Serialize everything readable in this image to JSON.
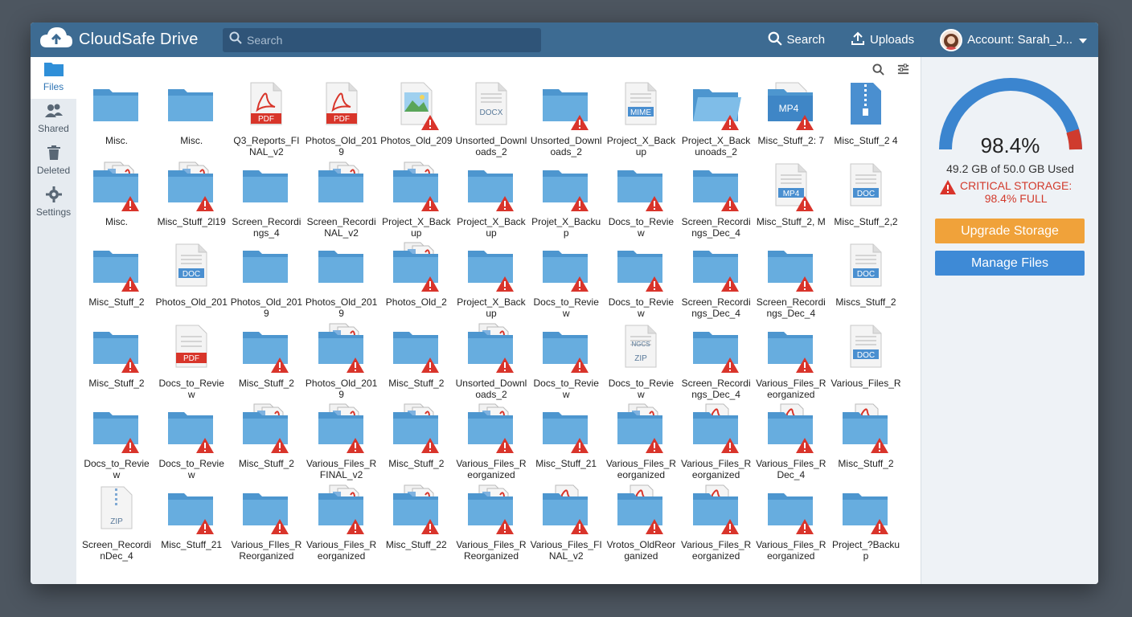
{
  "app": {
    "name": "CloudSafe Drive"
  },
  "search": {
    "placeholder": "Search"
  },
  "top": {
    "search_label": "Search",
    "uploads_label": "Uploads",
    "account_label": "Account: Sarah_J..."
  },
  "sidebar": {
    "items": [
      {
        "label": "Files",
        "icon": "folder-icon"
      },
      {
        "label": "Shared",
        "icon": "people-icon"
      },
      {
        "label": "Deleted",
        "icon": "trash-icon"
      },
      {
        "label": "Settings",
        "icon": "gear-icon"
      }
    ]
  },
  "storage": {
    "percent_label": "98.4%",
    "percent_value": 0.984,
    "used_label": "49.2 GB of 50.0 GB Used",
    "critical_line1": "CRITICAL STORAGE:",
    "critical_line2": "98.4% FULL",
    "upgrade_label": "Upgrade Storage",
    "manage_label": "Manage Files"
  },
  "colors": {
    "accent": "#3d6b92",
    "folder": "#5aa3d8",
    "warning": "#d9342b",
    "upgrade": "#f0a23a",
    "manage": "#3e8ad6"
  },
  "files": [
    {
      "name": "Misc.",
      "type": "folder",
      "warn": false
    },
    {
      "name": "Misc.",
      "type": "folder",
      "warn": false
    },
    {
      "name": "Q3_Reports_FINAL_v2",
      "type": "pdf",
      "warn": false
    },
    {
      "name": "Photos_Old_2019",
      "type": "pdf",
      "warn": false
    },
    {
      "name": "Photos_Old_209",
      "type": "image",
      "warn": true
    },
    {
      "name": "Unsorted_Downloads_2",
      "type": "docx",
      "warn": false
    },
    {
      "name": "Unsorted_Downloads_2",
      "type": "folder",
      "warn": true
    },
    {
      "name": "Project_X_Backup",
      "type": "mime",
      "warn": false
    },
    {
      "name": "Project_X_Backunoads_2",
      "type": "openfolder",
      "warn": true
    },
    {
      "name": "Misc_Stuff_2: 7",
      "type": "mp4folder",
      "warn": true
    },
    {
      "name": "Misc_Stuff_2 4",
      "type": "zipblue",
      "warn": false
    },
    {
      "name": "Misc.",
      "type": "stuffed",
      "warn": true
    },
    {
      "name": "Misc_Stuff_2l19",
      "type": "stuffed",
      "warn": true
    },
    {
      "name": "Screen_Recordings_4",
      "type": "folder",
      "warn": false
    },
    {
      "name": "Screen_RecordiNAL_v2",
      "type": "stuffed",
      "warn": false
    },
    {
      "name": "Project_X_Backup",
      "type": "stuffed",
      "warn": true
    },
    {
      "name": "Project_X_Backup",
      "type": "folder",
      "warn": true
    },
    {
      "name": "Projet_X_Backup",
      "type": "folder",
      "warn": true
    },
    {
      "name": "Docs_to_Review",
      "type": "folder",
      "warn": true
    },
    {
      "name": "Screen_Recordings_Dec_4",
      "type": "folder",
      "warn": true
    },
    {
      "name": "Misc_Stuff_2, M",
      "type": "mp4",
      "warn": true
    },
    {
      "name": "Misc_Stuff_2,2",
      "type": "doc",
      "warn": false
    },
    {
      "name": "Misc_Stuff_2",
      "type": "folder",
      "warn": true
    },
    {
      "name": "Photos_Old_201",
      "type": "doc",
      "warn": false
    },
    {
      "name": "Photos_Old_2019",
      "type": "folder",
      "warn": false
    },
    {
      "name": "Photos_Old_2019",
      "type": "folder",
      "warn": false
    },
    {
      "name": "Photos_Old_2",
      "type": "stuffed",
      "warn": true
    },
    {
      "name": "Project_X_Backup",
      "type": "folder",
      "warn": true
    },
    {
      "name": "Docs_to_Review",
      "type": "folder",
      "warn": true
    },
    {
      "name": "Docs_to_Review",
      "type": "folder",
      "warn": true
    },
    {
      "name": "Screen_Recordings_Dec_4",
      "type": "folder",
      "warn": true
    },
    {
      "name": "Screen_Recordings_Dec_4",
      "type": "folder",
      "warn": true
    },
    {
      "name": "Miscs_Stuff_2",
      "type": "doc",
      "warn": false
    },
    {
      "name": "Misc_Stuff_2",
      "type": "folder",
      "warn": true
    },
    {
      "name": "Docs_to_Review",
      "type": "pdfdoc",
      "warn": false
    },
    {
      "name": "Misc_Stuff_2",
      "type": "folder",
      "warn": true
    },
    {
      "name": "Photos_Old_2019",
      "type": "stuffed",
      "warn": true
    },
    {
      "name": "Misc_Stuff_2",
      "type": "folder",
      "warn": true
    },
    {
      "name": "Unsorted_Downloads_2",
      "type": "stuffed",
      "warn": true
    },
    {
      "name": "Docs_to_Review",
      "type": "folder",
      "warn": true
    },
    {
      "name": "Docs_to_Review",
      "type": "zip",
      "warn": false
    },
    {
      "name": "Screen_Recordings_Dec_4",
      "type": "folder",
      "warn": true
    },
    {
      "name": "Various_Files_Reorganized",
      "type": "folder",
      "warn": true
    },
    {
      "name": "Various_Files_R",
      "type": "doc",
      "warn": false
    },
    {
      "name": "Docs_to_Review",
      "type": "folder",
      "warn": true
    },
    {
      "name": "Docs_to_Review",
      "type": "folder",
      "warn": true
    },
    {
      "name": "Misc_Stuff_2",
      "type": "stuffed",
      "warn": true
    },
    {
      "name": "Various_Files_RFINAL_v2",
      "type": "stuffed",
      "warn": true
    },
    {
      "name": "Misc_Stuff_2",
      "type": "stuffed",
      "warn": true
    },
    {
      "name": "Various_Files_Reorganized",
      "type": "stuffed",
      "warn": true
    },
    {
      "name": "Misc_Stuff_21",
      "type": "folder",
      "warn": true
    },
    {
      "name": "Various_Files_Reorganized",
      "type": "stuffed",
      "warn": true
    },
    {
      "name": "Various_Files_Reorganized",
      "type": "pdffolder",
      "warn": true
    },
    {
      "name": "Various_Files_RDec_4",
      "type": "pdffolder",
      "warn": true
    },
    {
      "name": "Misc_Stuff_2",
      "type": "pdffolder",
      "warn": true
    },
    {
      "name": "Screen_RecordinDec_4",
      "type": "zipfile",
      "warn": false
    },
    {
      "name": "Misc_Stuff_21",
      "type": "folder",
      "warn": true
    },
    {
      "name": "Various_FIles_RReorganized",
      "type": "folder",
      "warn": true
    },
    {
      "name": "Various_Files_Reorganized",
      "type": "stuffed",
      "warn": true
    },
    {
      "name": "Misc_Stuff_22",
      "type": "stuffed",
      "warn": true
    },
    {
      "name": "Various_Files_RReorganized",
      "type": "stuffed",
      "warn": true
    },
    {
      "name": "Various_Files_FINAL_v2",
      "type": "pdffolder",
      "warn": true
    },
    {
      "name": "Vrotos_OldReorganized",
      "type": "pdffolder",
      "warn": true
    },
    {
      "name": "Various_Files_Reorganized",
      "type": "pdffolder",
      "warn": true
    },
    {
      "name": "Various_Files_Reorganized",
      "type": "folder",
      "warn": true
    },
    {
      "name": "Project_?Backup",
      "type": "folder",
      "warn": true
    }
  ]
}
